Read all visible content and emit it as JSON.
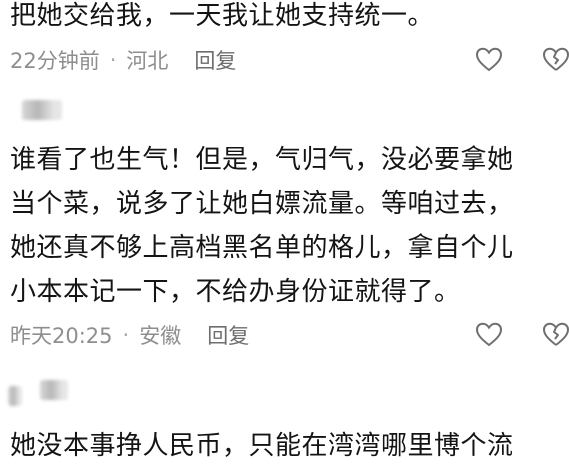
{
  "comments": [
    {
      "lines": [
        "把她交给我，一天我让她支持统一。"
      ],
      "time": "22分钟前",
      "separator": "·",
      "location": "河北",
      "reply_label": "回复"
    },
    {
      "lines": [
        "谁看了也生气！但是，气归气，没必要拿她",
        "当个菜，说多了让她白嫖流量。等咱过去，",
        "她还真不够上高档黑名单的格儿，拿自个儿",
        "小本本记一下，不给办身份证就得了。"
      ],
      "time": "昨天20:25",
      "separator": "·",
      "location": "安徽",
      "reply_label": "回复"
    },
    {
      "lines": [
        "她没本事挣人民币，只能在湾湾哪里博个流"
      ]
    }
  ]
}
